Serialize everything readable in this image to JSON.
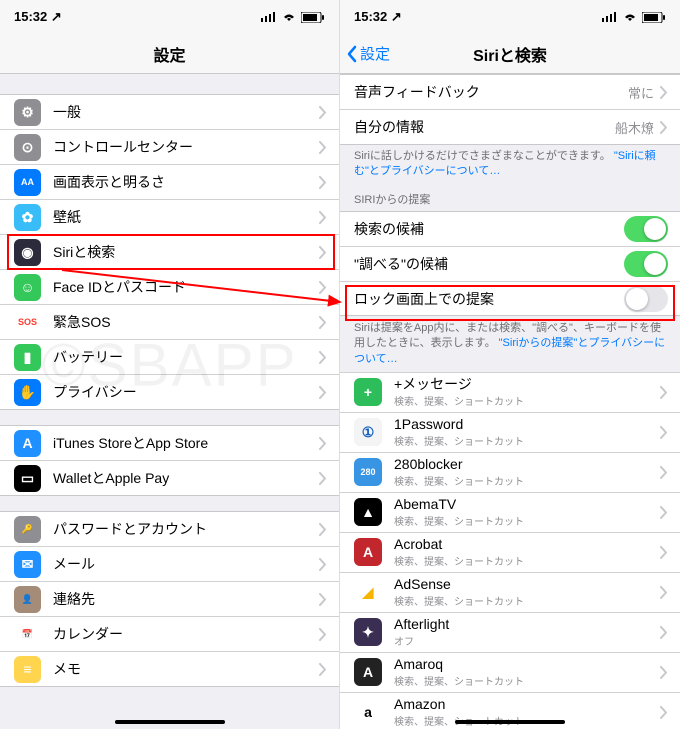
{
  "status": {
    "time": "15:32",
    "loc_icon": "↗"
  },
  "left": {
    "title": "設定",
    "groups": [
      [
        {
          "key": "general",
          "label": "一般",
          "icon_bg": "#8e8e93",
          "glyph": "⚙"
        },
        {
          "key": "control-center",
          "label": "コントロールセンター",
          "icon_bg": "#8e8e93",
          "glyph": "⊙"
        },
        {
          "key": "display",
          "label": "画面表示と明るさ",
          "icon_bg": "#007aff",
          "glyph": "AA"
        },
        {
          "key": "wallpaper",
          "label": "壁紙",
          "icon_bg": "#38bdf8",
          "glyph": "✿"
        },
        {
          "key": "siri",
          "label": "Siriと検索",
          "icon_bg": "#2b2b3b",
          "glyph": "◉"
        },
        {
          "key": "faceid",
          "label": "Face IDとパスコード",
          "icon_bg": "#34c759",
          "glyph": "☺"
        },
        {
          "key": "sos",
          "label": "緊急SOS",
          "icon_bg": "#ffffff",
          "glyph": "SOS",
          "glyph_color": "#ff3b30"
        },
        {
          "key": "battery",
          "label": "バッテリー",
          "icon_bg": "#34c759",
          "glyph": "▮"
        },
        {
          "key": "privacy",
          "label": "プライバシー",
          "icon_bg": "#007aff",
          "glyph": "✋"
        }
      ],
      [
        {
          "key": "appstore",
          "label": "iTunes StoreとApp Store",
          "icon_bg": "#1e90ff",
          "glyph": "A"
        },
        {
          "key": "wallet",
          "label": "WalletとApple Pay",
          "icon_bg": "#000",
          "glyph": "▭"
        }
      ],
      [
        {
          "key": "passwords",
          "label": "パスワードとアカウント",
          "icon_bg": "#8e8e93",
          "glyph": "🔑"
        },
        {
          "key": "mail",
          "label": "メール",
          "icon_bg": "#1e90ff",
          "glyph": "✉"
        },
        {
          "key": "contacts",
          "label": "連絡先",
          "icon_bg": "#a48c78",
          "glyph": "👤"
        },
        {
          "key": "calendar",
          "label": "カレンダー",
          "icon_bg": "#ffffff",
          "glyph": "📅",
          "glyph_color": "#ff3b30"
        },
        {
          "key": "notes",
          "label": "メモ",
          "icon_bg": "#ffd54f",
          "glyph": "≡"
        }
      ]
    ]
  },
  "right": {
    "back": "設定",
    "title": "Siriと検索",
    "top_rows": [
      {
        "key": "voice-feedback",
        "label": "音声フィードバック",
        "detail": "常に"
      },
      {
        "key": "my-info",
        "label": "自分の情報",
        "detail": "船木燎"
      }
    ],
    "footer1_a": "Siriに話しかけるだけでさまざまなことができます。",
    "footer1_link": "\"Siriに頼む\"とプライバシーについて…",
    "section_header": "SIRIからの提案",
    "toggles": [
      {
        "key": "search-suggest",
        "label": "検索の候補",
        "on": true
      },
      {
        "key": "lookup-suggest",
        "label": "\"調べる\"の候補",
        "on": true
      },
      {
        "key": "lock-suggest",
        "label": "ロック画面上での提案",
        "on": false
      }
    ],
    "footer2_a": "Siriは提案をApp内に、または検索、\"調べる\"、キーボードを使用したときに、表示します。",
    "footer2_link": "\"Siriからの提案\"とプライバシーについて…",
    "app_sub_default": "検索、提案、ショートカット",
    "apps": [
      {
        "name": "+メッセージ",
        "sub": "検索、提案、ショートカット",
        "bg": "#2dbd5a",
        "glyph": "+"
      },
      {
        "name": "1Password",
        "sub": "検索、提案、ショートカット",
        "bg": "#f4f4f4",
        "glyph": "①",
        "gc": "#1560bd"
      },
      {
        "name": "280blocker",
        "sub": "検索、提案、ショートカット",
        "bg": "#3795e4",
        "glyph": "280"
      },
      {
        "name": "AbemaTV",
        "sub": "検索、提案、ショートカット",
        "bg": "#000",
        "glyph": "▲"
      },
      {
        "name": "Acrobat",
        "sub": "検索、提案、ショートカット",
        "bg": "#c1272d",
        "glyph": "A"
      },
      {
        "name": "AdSense",
        "sub": "検索、提案、ショートカット",
        "bg": "#fff",
        "glyph": "◢",
        "gc": "#f8b500"
      },
      {
        "name": "Afterlight",
        "sub": "オフ",
        "bg": "#3a2e52",
        "glyph": "✦"
      },
      {
        "name": "Amaroq",
        "sub": "検索、提案、ショートカット",
        "bg": "#222",
        "glyph": "A"
      },
      {
        "name": "Amazon",
        "sub": "検索、提案、ショートカット",
        "bg": "#fff",
        "glyph": "a",
        "gc": "#000"
      }
    ]
  },
  "watermark": "©SBAPP"
}
